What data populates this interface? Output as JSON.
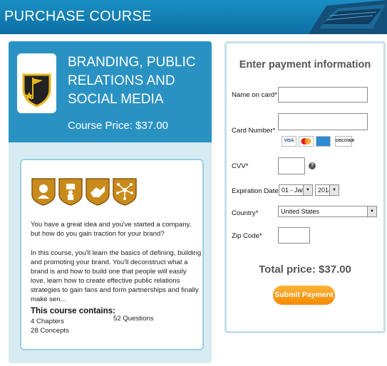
{
  "header": {
    "title": "PURCHASE COURSE"
  },
  "course": {
    "title_lines": [
      "BRANDING, PUBLIC",
      "RELATIONS AND",
      "SOCIAL MEDIA"
    ],
    "price_label": "Course Price: $37.00",
    "intro": "You have a great idea and you've started a company, but how do you gain traction for your brand?",
    "body": "In this course, you'll learn the basics of defining, building and promoting your brand. You'll deconstruct what a brand is and how to build one that people will easily love, learn how to create effective public relations strategies to gain fans and form partnerships and finally make sen...",
    "contains_title": "This course contains:",
    "chapters": "4 Chapters",
    "concepts": "28 Concepts",
    "questions": "52 Questions",
    "badges": [
      "head-silhouette-badge",
      "presenter-badge",
      "handshake-badge",
      "network-badge"
    ]
  },
  "payment": {
    "title": "Enter payment information",
    "name_label": "Name on card*",
    "name_value": "",
    "card_label": "Card Number*",
    "card_value": "",
    "card_logos": [
      "VISA",
      "MasterCard",
      "AMEX",
      "DISCOVER"
    ],
    "cvv_label": "CVV*",
    "cvv_value": "",
    "help_glyph": "?",
    "expiry_label": "Expiration Date*",
    "expiry_month": "01 - Jan",
    "expiry_year": "2014",
    "country_label": "Country*",
    "country_value": "United States",
    "zip_label": "Zip Code*",
    "zip_value": "",
    "total": "Total price: $37.00",
    "submit": "Submit Payment"
  },
  "colors": {
    "header_blue": "#1a8fc4",
    "panel_blue": "#2a92c3",
    "panel_light": "#d7ebf2",
    "badge_gold": "#c98a1c",
    "submit_orange": "#f58a00"
  }
}
